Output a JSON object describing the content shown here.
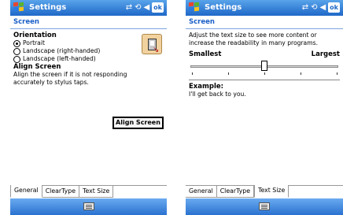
{
  "left_screen": {
    "title": "Settings",
    "ok": "ok",
    "page_title": "Screen",
    "orientation": {
      "heading": "Orientation",
      "options": [
        {
          "label": "Portrait",
          "selected": true
        },
        {
          "label": "Landscape (right-handed)",
          "selected": false
        },
        {
          "label": "Landscape (left-handed)",
          "selected": false
        }
      ]
    },
    "align": {
      "heading": "Align Screen",
      "description": "Align the screen if it is not responding accurately to stylus taps.",
      "button": "Align Screen"
    },
    "tabs": [
      "General",
      "ClearType",
      "Text Size"
    ],
    "active_tab": "General"
  },
  "right_screen": {
    "title": "Settings",
    "ok": "ok",
    "page_title": "Screen",
    "description": "Adjust the text size to see more content or increase the readability in many programs.",
    "slider": {
      "min_label": "Smallest",
      "max_label": "Largest",
      "steps": 5,
      "value": 2
    },
    "example_label": "Example:",
    "example_text": "I'll get back to you.",
    "tabs": [
      "General",
      "ClearType",
      "Text Size"
    ],
    "active_tab": "Text Size"
  },
  "icons": {
    "tray": [
      "connectivity-icon",
      "sync-icon",
      "volume-icon"
    ],
    "start": "windows-flag-icon",
    "input": "keyboard-icon"
  },
  "colors": {
    "titlebar": "#1f68c8",
    "accent": "#1a5fc7"
  }
}
